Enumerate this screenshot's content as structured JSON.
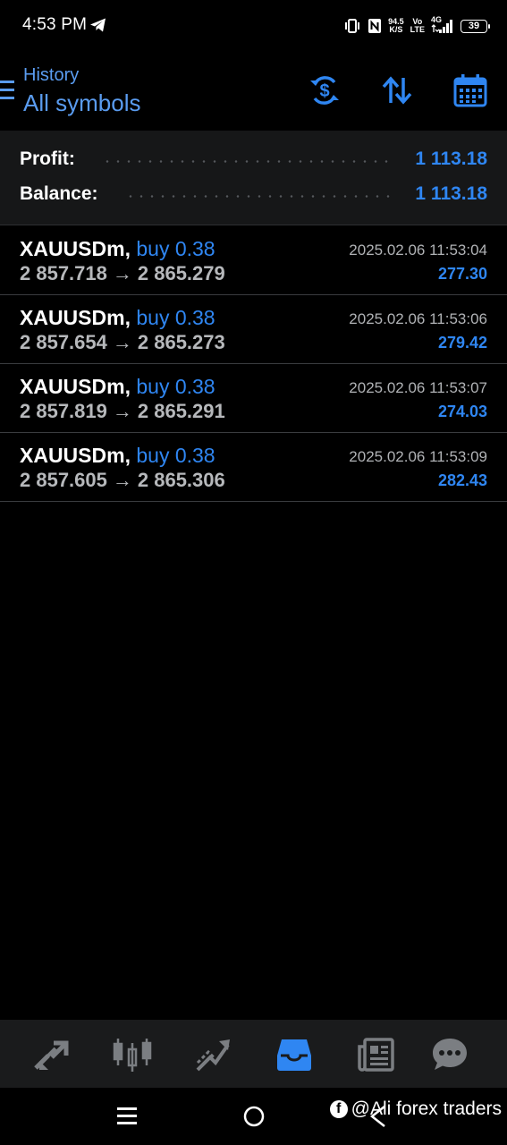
{
  "status_bar": {
    "time": "4:53 PM",
    "net_speed_value": "94.5",
    "net_speed_unit": "K/S",
    "volte_top": "Vo",
    "volte_bottom": "LTE",
    "network": "4G",
    "battery": "39"
  },
  "header": {
    "subtitle": "History",
    "title": "All symbols",
    "icons": [
      "menu-icon",
      "currency-exchange-icon",
      "sort-icon",
      "calendar-icon"
    ]
  },
  "summary": {
    "profit_label": "Profit:",
    "profit_value": "1 113.18",
    "balance_label": "Balance:",
    "balance_value": "1 113.18"
  },
  "deals": [
    {
      "symbol": "XAUUSDm,",
      "type": "buy 0.38",
      "open_price": "2 857.718",
      "arrow": "→",
      "close_price": "2 865.279",
      "time": "2025.02.06 11:53:04",
      "profit": "277.30"
    },
    {
      "symbol": "XAUUSDm,",
      "type": "buy 0.38",
      "open_price": "2 857.654",
      "arrow": "→",
      "close_price": "2 865.273",
      "time": "2025.02.06 11:53:06",
      "profit": "279.42"
    },
    {
      "symbol": "XAUUSDm,",
      "type": "buy 0.38",
      "open_price": "2 857.819",
      "arrow": "→",
      "close_price": "2 865.291",
      "time": "2025.02.06 11:53:07",
      "profit": "274.03"
    },
    {
      "symbol": "XAUUSDm,",
      "type": "buy 0.38",
      "open_price": "2 857.605",
      "arrow": "→",
      "close_price": "2 865.306",
      "time": "2025.02.06 11:53:09",
      "profit": "282.43"
    }
  ],
  "bottom_nav": {
    "items": [
      "quotes-icon",
      "chart-icon",
      "trade-icon",
      "history-icon",
      "news-icon",
      "chat-icon"
    ],
    "active": "history-icon"
  },
  "watermark": {
    "text": "@Ali forex traders"
  },
  "colors": {
    "accent": "#2f86f2",
    "header_blue": "#5a9cf0",
    "background": "#000000",
    "summary_bg": "#161718",
    "nav_bg": "#1a1b1c",
    "price_text": "#b6b8bb"
  }
}
